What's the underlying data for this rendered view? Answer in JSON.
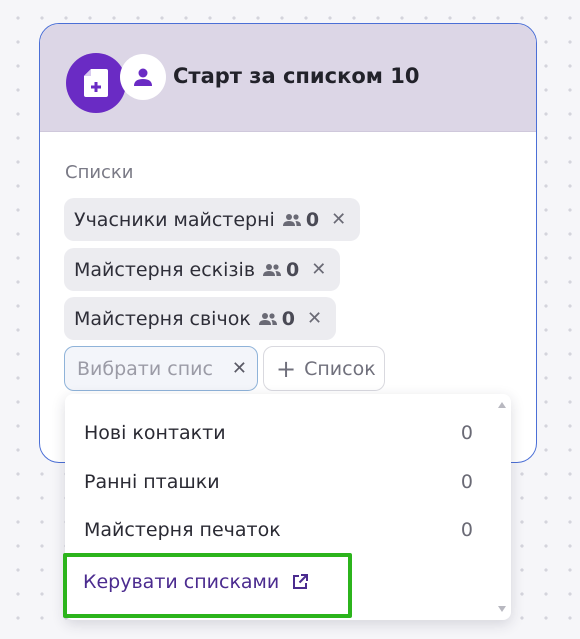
{
  "card": {
    "title": "Старт за списком 10",
    "section_label": "Списки"
  },
  "chips": [
    {
      "label": "Учасники майстерні",
      "count": "0",
      "remove": "✕"
    },
    {
      "label": "Майстерня ескізів",
      "count": "0",
      "remove": "✕"
    },
    {
      "label": "Майстерня свічок",
      "count": "0",
      "remove": "✕"
    }
  ],
  "select": {
    "placeholder": "Вибрати спис",
    "clear": "✕"
  },
  "add_list": {
    "plus": "+",
    "label": "Список"
  },
  "dropdown": {
    "items": [
      {
        "label": "Нові контакти",
        "count": "0"
      },
      {
        "label": "Ранні пташки",
        "count": "0"
      },
      {
        "label": "Майстерня печаток",
        "count": "0"
      }
    ],
    "manage_label": "Керувати списками"
  },
  "colors": {
    "accent_purple": "#6a2bc4",
    "header_bg": "#dcd6e6",
    "highlight_green": "#2cb41c",
    "card_border": "#4b6fd6"
  },
  "icons": {
    "main_badge": "add-document-icon",
    "user_badge": "person-icon",
    "chip_people": "people-icon",
    "manage_external": "external-link-icon"
  }
}
